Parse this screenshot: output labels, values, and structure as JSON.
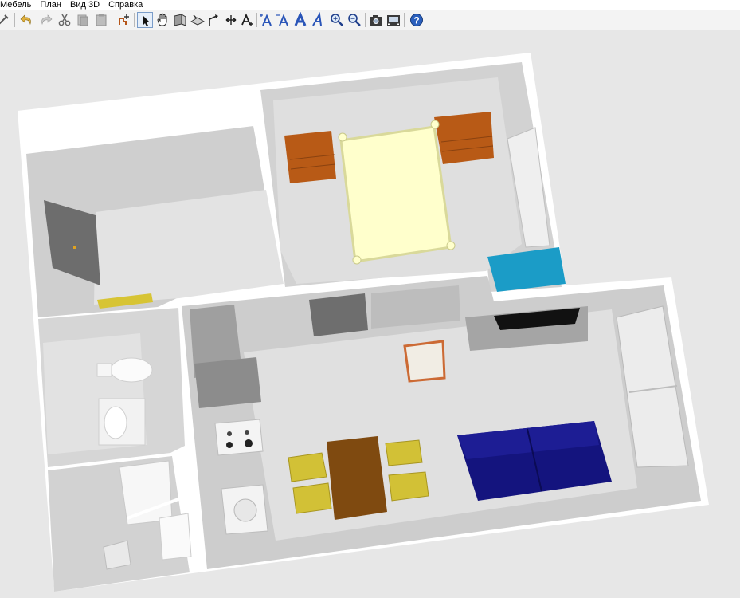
{
  "menu": [
    "Мебель",
    "План",
    "Вид 3D",
    "Справка"
  ],
  "toolbar": {
    "buttons": [
      {
        "name": "preferences-tool-icon",
        "selected": false
      },
      {
        "name": "undo-icon",
        "selected": false
      },
      {
        "name": "redo-icon",
        "selected": false
      },
      {
        "name": "cut-icon",
        "selected": false
      },
      {
        "name": "copy-icon",
        "selected": false
      },
      {
        "name": "paste-icon",
        "selected": false
      },
      {
        "name": "add-furniture-icon",
        "selected": false
      },
      {
        "name": "select-pointer-icon",
        "selected": true
      },
      {
        "name": "pan-hand-icon",
        "selected": false
      },
      {
        "name": "create-walls-icon",
        "selected": false
      },
      {
        "name": "create-rooms-icon",
        "selected": false
      },
      {
        "name": "create-polylines-icon",
        "selected": false
      },
      {
        "name": "create-dimensions-icon",
        "selected": false
      },
      {
        "name": "add-text-icon",
        "selected": false
      },
      {
        "name": "increase-text-size-icon",
        "selected": false
      },
      {
        "name": "decrease-text-size-icon",
        "selected": false
      },
      {
        "name": "bold-text-icon",
        "selected": false
      },
      {
        "name": "italic-text-icon",
        "selected": false
      },
      {
        "name": "zoom-in-icon",
        "selected": false
      },
      {
        "name": "zoom-out-icon",
        "selected": false
      },
      {
        "name": "create-photo-icon",
        "selected": false
      },
      {
        "name": "create-video-icon",
        "selected": false
      },
      {
        "name": "help-icon",
        "selected": false
      }
    ]
  },
  "scene": {
    "view": "3D top view",
    "rooms": [
      "bedroom",
      "hallway",
      "bathroom",
      "kitchen-living room"
    ],
    "colors": {
      "background": "#e7e7e7",
      "wall": "#ffffff",
      "floor": "#dedede",
      "bed": "#ffffcc",
      "nightstand": "#b85a16",
      "sofa": "#14147e",
      "table": "#7f4a10",
      "chair": "#d2c136",
      "blue_box": "#1b9cc7"
    }
  }
}
